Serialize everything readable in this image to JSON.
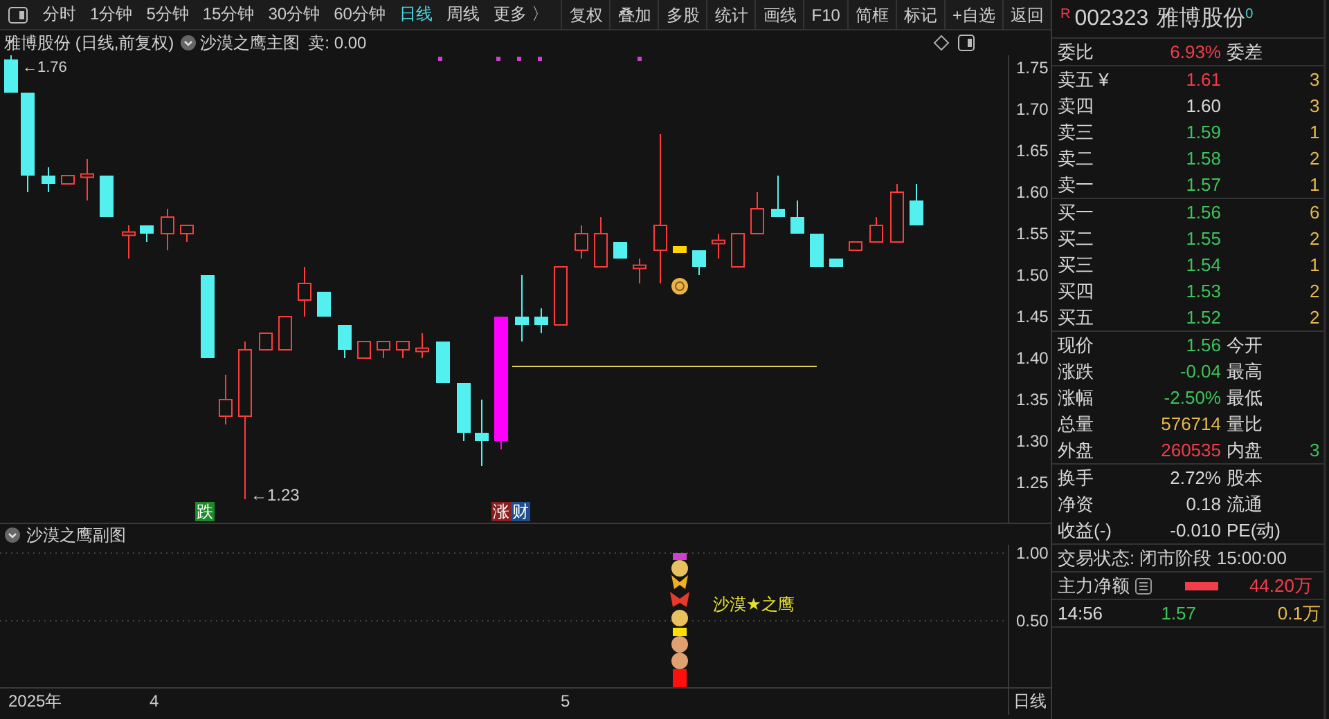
{
  "toolbar": {
    "periods": [
      {
        "label": "分时",
        "selected": false
      },
      {
        "label": "1分钟",
        "selected": false
      },
      {
        "label": "5分钟",
        "selected": false
      },
      {
        "label": "15分钟",
        "selected": false
      },
      {
        "label": "30分钟",
        "selected": false
      },
      {
        "label": "60分钟",
        "selected": false
      },
      {
        "label": "日线",
        "selected": true
      },
      {
        "label": "周线",
        "selected": false
      }
    ],
    "more": "更多 〉",
    "buttons": [
      "复权",
      "叠加",
      "多股",
      "统计",
      "画线",
      "F10",
      "简框",
      "标记",
      "+自选",
      "返回"
    ]
  },
  "main_chart": {
    "title": "雅博股份 (日线,前复权)",
    "indicator": "沙漠之鹰主图",
    "reading": "卖: 0.00",
    "y_axis_labels": [
      "1.75",
      "1.70",
      "1.65",
      "1.60",
      "1.55",
      "1.50",
      "1.45",
      "1.40",
      "1.35",
      "1.30",
      "1.25"
    ],
    "high_marker": "←1.76",
    "low_marker": "←1.23",
    "tags": [
      {
        "text": "跌",
        "kind": "fall"
      },
      {
        "text": "涨",
        "kind": "rise"
      },
      {
        "text": "财",
        "kind": "wealth"
      }
    ]
  },
  "sub_chart": {
    "title": "沙漠之鹰副图",
    "y_axis_labels": [
      "1.00",
      "0.50"
    ],
    "signal_label": "沙漠★之鹰"
  },
  "time_axis": {
    "labels": [
      "2025年",
      "4",
      "5"
    ],
    "period": "日线"
  },
  "quote": {
    "flag": "R",
    "code": "002323",
    "name": "雅博股份",
    "badge": "0",
    "sections": [
      [
        {
          "label": "委比",
          "value": "6.93%",
          "color": "#f23d4a",
          "label2": "委差"
        }
      ],
      [
        {
          "label": "卖五 ¥",
          "value": "1.61",
          "color": "#f23d4a",
          "extra": "3"
        },
        {
          "label": "卖四",
          "value": "1.60",
          "color": "#d8d8d8",
          "extra": "3"
        },
        {
          "label": "卖三",
          "value": "1.59",
          "color": "#3cc35a",
          "extra": "1"
        },
        {
          "label": "卖二",
          "value": "1.58",
          "color": "#3cc35a",
          "extra": "2"
        },
        {
          "label": "卖一",
          "value": "1.57",
          "color": "#3cc35a",
          "extra": "1"
        }
      ],
      [
        {
          "label": "买一",
          "value": "1.56",
          "color": "#3cc35a",
          "extra": "6"
        },
        {
          "label": "买二",
          "value": "1.55",
          "color": "#3cc35a",
          "extra": "2"
        },
        {
          "label": "买三",
          "value": "1.54",
          "color": "#3cc35a",
          "extra": "1"
        },
        {
          "label": "买四",
          "value": "1.53",
          "color": "#3cc35a",
          "extra": "2"
        },
        {
          "label": "买五",
          "value": "1.52",
          "color": "#3cc35a",
          "extra": "2"
        }
      ],
      [
        {
          "label": "现价",
          "value": "1.56",
          "color": "#3cc35a",
          "label2": "今开"
        },
        {
          "label": "涨跌",
          "value": "-0.04",
          "color": "#3cc35a",
          "label2": "最高"
        },
        {
          "label": "涨幅",
          "value": "-2.50%",
          "color": "#3cc35a",
          "label2": "最低"
        },
        {
          "label": "总量",
          "value": "576714",
          "color": "#e6b84e",
          "label2": "量比"
        },
        {
          "label": "外盘",
          "value": "260535",
          "color": "#f23d4a",
          "label2": "内盘",
          "extra": "3"
        }
      ],
      [
        {
          "label": "换手",
          "value": "2.72%",
          "color": "#d8d8d8",
          "label2": "股本"
        },
        {
          "label": "净资",
          "value": "0.18",
          "color": "#d8d8d8",
          "label2": "流通"
        },
        {
          "label": "收益(-)",
          "value": "-0.010",
          "color": "#d8d8d8",
          "label2": "PE(动)"
        }
      ]
    ],
    "trade_status": "交易状态: 闭市阶段 15:00:00",
    "main_flow": {
      "label": "主力净额",
      "value": "44.20万"
    },
    "tick": {
      "time": "14:56",
      "price": "1.57",
      "color": "#3cc35a",
      "volume": "0.1万"
    }
  }
}
